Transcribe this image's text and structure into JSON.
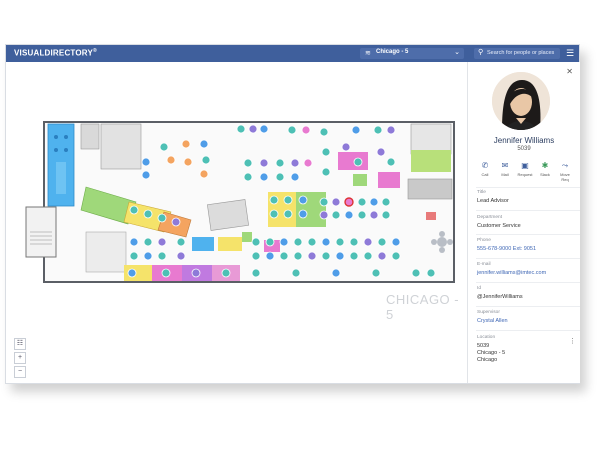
{
  "app": {
    "brand": "VISUALDIRECTORY",
    "brand_mark": "®"
  },
  "header": {
    "location_select": "Chicago - 5",
    "search_placeholder": "Search for people or places",
    "layers_icon": "layers-icon",
    "search_icon": "search-icon",
    "menu_icon": "hamburger-icon"
  },
  "map": {
    "floor_label": "CHICAGO - 5",
    "zoom_in": "+",
    "zoom_out": "−",
    "list_icon": "list-icon"
  },
  "person": {
    "name": "Jennifer Williams",
    "id": "5039",
    "actions": [
      {
        "label": "Call",
        "icon": "phone-icon"
      },
      {
        "label": "Mail",
        "icon": "mail-icon"
      },
      {
        "label": "Request",
        "icon": "request-icon"
      },
      {
        "label": "Slack",
        "icon": "slack-icon"
      },
      {
        "label": "Move Req",
        "icon": "move-icon"
      }
    ],
    "fields": [
      {
        "label": "Title",
        "value": "Lead Advisor",
        "link": false
      },
      {
        "label": "Department",
        "value": "Customer Service",
        "link": false
      },
      {
        "label": "Phone",
        "value": "555-678-9000 Ext: 9051",
        "link": true
      },
      {
        "label": "E-mail",
        "value": "jennifer.williams@imtec.com",
        "link": true
      },
      {
        "label": "Id",
        "value": "@JenniferWilliams",
        "link": false
      },
      {
        "label": "Supervisor",
        "value": "Crystal Allen",
        "link": true
      },
      {
        "label": "Location",
        "value": "5039",
        "value2": "Chicago - 5",
        "value3": "Chicago",
        "link": false
      }
    ]
  },
  "colors": {
    "header": "#3f5f9c",
    "accent_blue": "#4f9de8",
    "desk_teal": "#4ec0b5",
    "desk_purple": "#8e7ad8",
    "zone_pink": "#e87ad0",
    "zone_green": "#9fd87a",
    "zone_yellow": "#f5e36a",
    "zone_orange": "#f4a460"
  }
}
